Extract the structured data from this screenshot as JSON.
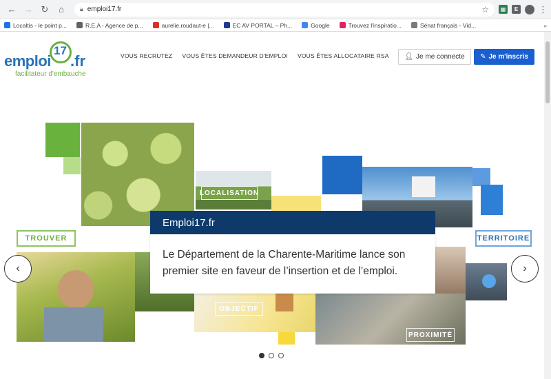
{
  "browser": {
    "url": "emploi17.fr",
    "bookmarks": [
      {
        "label": "Localtis - le point p...",
        "color": "#1a73e8"
      },
      {
        "label": "R.E.A - Agence de p...",
        "color": "#5f6368"
      },
      {
        "label": "aurelie.roudaut-e |...",
        "color": "#d93025"
      },
      {
        "label": "EC AV PORTAL – Ph...",
        "color": "#1a3b8f"
      },
      {
        "label": "Google",
        "color": "#4285f4"
      },
      {
        "label": "Trouvez l'inspiratio...",
        "color": "#e0245e"
      },
      {
        "label": "Sénat français - Vid...",
        "color": "#7a7a7a"
      }
    ],
    "more_bookmarks": "»"
  },
  "header": {
    "logo_main": "emploi",
    "logo_number": "17",
    "logo_tld": ".fr",
    "logo_tagline": "facilitateur d'embauche",
    "nav": [
      "VOUS RECRUTEZ",
      "VOUS ÊTES DEMANDEUR D'EMPLOI",
      "VOUS ÊTES ALLOCATAIRE RSA"
    ],
    "connect_label": "Je me connecte",
    "signup_label": "Je m'inscris"
  },
  "hero": {
    "card_title": "Emploi17.fr",
    "card_text": "Le Département de la Charente-Maritime lance son premier site en faveur de l’insertion et de l’emploi.",
    "tags": {
      "trouver": "TROUVER",
      "territoire": "TERRITOIRE",
      "localisation": "LOCALISATION",
      "objectif": "OBJECTIF",
      "proximite": "PROXIMITÉ"
    },
    "prev": "‹",
    "next": "›"
  },
  "carousel": {
    "slides": 3,
    "active": 1
  },
  "colors": {
    "brand_blue": "#2a73b7",
    "brand_green": "#6ab23e",
    "signup_blue": "#1a5fd0",
    "card_navy": "#0e3a6b"
  }
}
